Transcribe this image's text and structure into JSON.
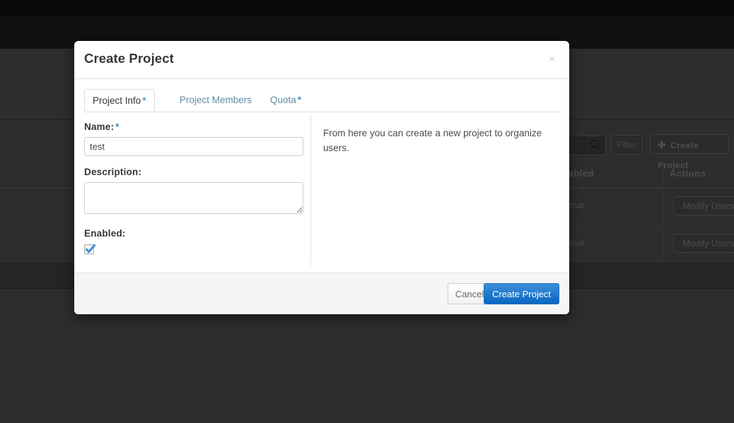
{
  "background": {
    "toolbar": {
      "search_placeholder": "",
      "search_icon": "search-icon",
      "filter_label": "Filter",
      "create_project_label": "Create Project",
      "create_project_icon": "plus-icon"
    },
    "table": {
      "columns": [
        "Enabled",
        "Actions"
      ],
      "rows": [
        {
          "enabled": "true",
          "action_label": "Modify Users"
        },
        {
          "enabled": "true",
          "action_label": "Modify Users"
        }
      ]
    }
  },
  "modal": {
    "title": "Create Project",
    "close_label": "×",
    "tabs": [
      {
        "label": "Project Info",
        "required": true,
        "active": true
      },
      {
        "label": "Project Members",
        "required": false,
        "active": false
      },
      {
        "label": "Quota",
        "required": true,
        "active": false
      }
    ],
    "required_marker": "*",
    "form": {
      "name_label": "Name:",
      "name_value": "test",
      "name_placeholder": "",
      "description_label": "Description:",
      "description_value": "",
      "description_placeholder": "",
      "enabled_label": "Enabled:",
      "enabled_checked": true
    },
    "help_text": "From here you can create a new project to organize users.",
    "footer": {
      "cancel_label": "Cancel",
      "submit_label": "Create Project"
    }
  },
  "colors": {
    "primary": "#0a66c2",
    "link": "#5c8ca8",
    "required": "#3b90c4",
    "overlay": "#2d2d2d"
  }
}
